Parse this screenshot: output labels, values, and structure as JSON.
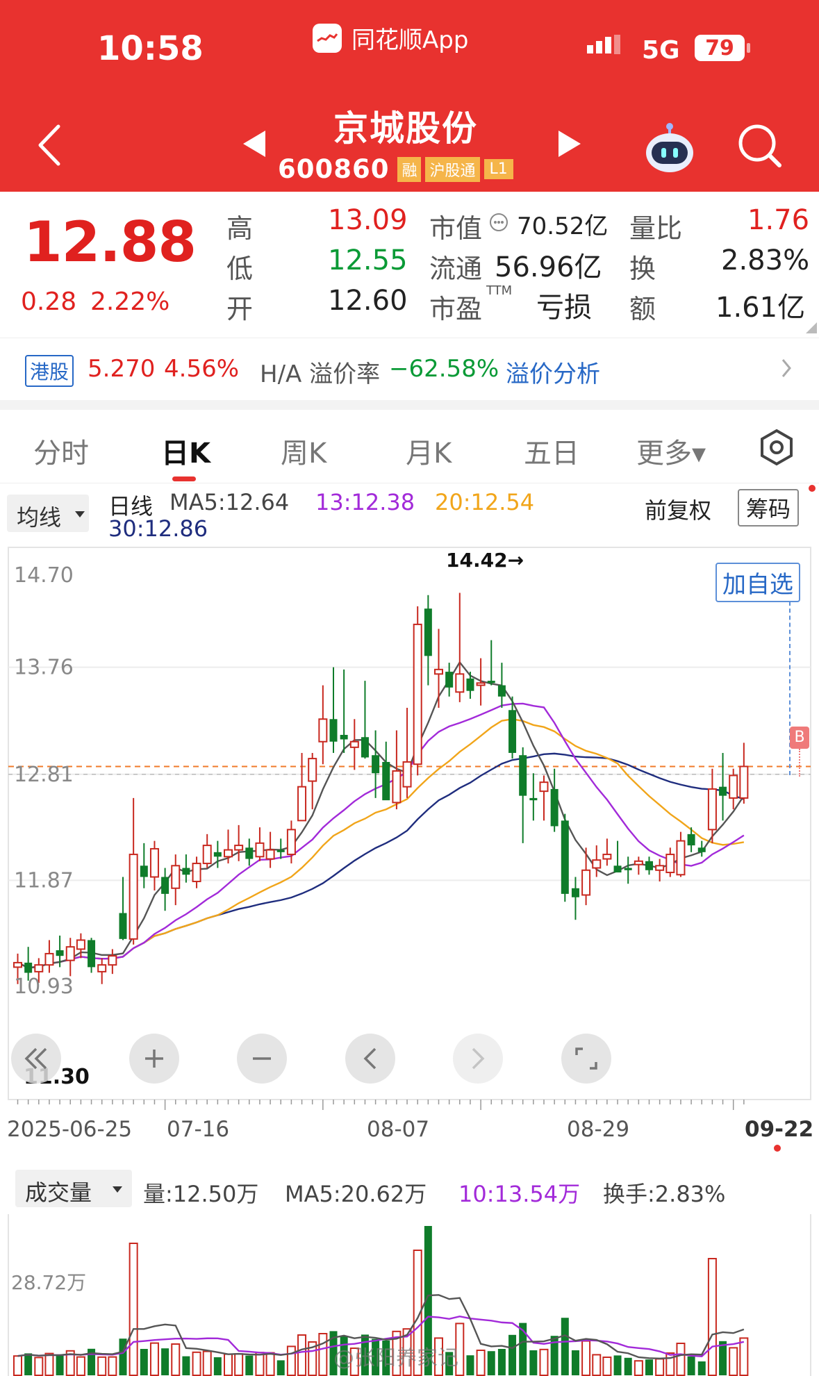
{
  "status_bar": {
    "time": "10:58",
    "app_label": "同花顺App",
    "network": "5G",
    "battery": "79"
  },
  "stock": {
    "name": "京城股份",
    "code": "600860",
    "badges": [
      "融",
      "沪股通",
      "L1"
    ]
  },
  "quote": {
    "price": "12.88",
    "change": "0.28",
    "change_pct": "2.22%",
    "high_label": "高",
    "high": "13.09",
    "low_label": "低",
    "low": "12.55",
    "open_label": "开",
    "open": "12.60",
    "mktcap_label": "市值",
    "mktcap": "70.52亿",
    "float_label": "流通",
    "float_cap": "56.96亿",
    "pe_label": "市盈",
    "pe_sup": "TTM",
    "pe": "亏损",
    "vol_ratio_label": "量比",
    "vol_ratio": "1.76",
    "turnover_label": "换",
    "turnover": "2.83%",
    "amount_label": "额",
    "amount": "1.61亿"
  },
  "hk": {
    "tag": "港股",
    "price": "5.270",
    "pct": "4.56%",
    "premium_label": "H/A 溢价率",
    "premium": "−62.58%",
    "analysis": "溢价分析"
  },
  "tabs": [
    {
      "label": "分时"
    },
    {
      "label": "日K"
    },
    {
      "label": "周K"
    },
    {
      "label": "月K"
    },
    {
      "label": "五日"
    },
    {
      "label": "更多▾"
    }
  ],
  "active_tab": "日K",
  "chart_header": {
    "indicator_btn": "均线",
    "line_label": "日线",
    "ma5": "MA5:12.64",
    "ma13": "13:12.38",
    "ma20": "20:12.54",
    "ma30": "30:12.86",
    "adjust": "前复权",
    "chips": "筹码"
  },
  "colors": {
    "up": "#c8281f",
    "down": "#0f7c2a",
    "ma5": "#555555",
    "ma13": "#a22ad9",
    "ma20": "#f1a51a",
    "ma30": "#1f2d7e",
    "brand": "#e8322f"
  },
  "add_watch": "加自选",
  "buy_marker": "B",
  "volume_header": {
    "btn": "成交量",
    "vol": "量:12.50万",
    "ma5": "MA5:20.62万",
    "ma10": "10:13.54万",
    "turnover": "换手:2.83%"
  },
  "watermark": "@张阳养家记",
  "chart_data": {
    "type": "candlestick",
    "y_ticks": [
      "14.70",
      "13.76",
      "12.81",
      "11.87",
      "10.93"
    ],
    "ylim": [
      10.93,
      14.7
    ],
    "x_ticks": [
      "2025-06-25",
      "07-16",
      "08-07",
      "08-29",
      "09-22"
    ],
    "max_annotation": "14.42→",
    "min_annotation": "11.30",
    "last_price_line": 12.88,
    "candles": [
      {
        "o": 11.1,
        "h": 11.22,
        "l": 10.95,
        "c": 11.14
      },
      {
        "o": 11.14,
        "h": 11.28,
        "l": 10.98,
        "c": 11.05
      },
      {
        "o": 11.06,
        "h": 11.18,
        "l": 10.96,
        "c": 11.12
      },
      {
        "o": 11.12,
        "h": 11.34,
        "l": 11.05,
        "c": 11.22
      },
      {
        "o": 11.25,
        "h": 11.38,
        "l": 11.1,
        "c": 11.2
      },
      {
        "o": 11.16,
        "h": 11.36,
        "l": 11.02,
        "c": 11.28
      },
      {
        "o": 11.26,
        "h": 11.4,
        "l": 11.18,
        "c": 11.34
      },
      {
        "o": 11.34,
        "h": 11.36,
        "l": 11.05,
        "c": 11.1
      },
      {
        "o": 11.06,
        "h": 11.18,
        "l": 10.95,
        "c": 11.12
      },
      {
        "o": 11.12,
        "h": 11.26,
        "l": 11.04,
        "c": 11.2
      },
      {
        "o": 11.58,
        "h": 11.9,
        "l": 11.34,
        "c": 11.35
      },
      {
        "o": 11.35,
        "h": 12.6,
        "l": 11.3,
        "c": 12.1
      },
      {
        "o": 12.0,
        "h": 12.2,
        "l": 11.8,
        "c": 11.9
      },
      {
        "o": 11.9,
        "h": 12.22,
        "l": 11.78,
        "c": 12.15
      },
      {
        "o": 11.9,
        "h": 11.98,
        "l": 11.6,
        "c": 11.75
      },
      {
        "o": 11.8,
        "h": 12.1,
        "l": 11.65,
        "c": 12.0
      },
      {
        "o": 11.98,
        "h": 12.1,
        "l": 11.85,
        "c": 11.92
      },
      {
        "o": 11.86,
        "h": 12.08,
        "l": 11.8,
        "c": 12.02
      },
      {
        "o": 12.02,
        "h": 12.28,
        "l": 11.98,
        "c": 12.18
      },
      {
        "o": 12.12,
        "h": 12.22,
        "l": 11.98,
        "c": 12.08
      },
      {
        "o": 12.08,
        "h": 12.32,
        "l": 12.02,
        "c": 12.14
      },
      {
        "o": 12.14,
        "h": 12.36,
        "l": 12.04,
        "c": 12.18
      },
      {
        "o": 12.16,
        "h": 12.24,
        "l": 12.0,
        "c": 12.06
      },
      {
        "o": 12.08,
        "h": 12.34,
        "l": 12.04,
        "c": 12.2
      },
      {
        "o": 12.06,
        "h": 12.3,
        "l": 11.98,
        "c": 12.14
      },
      {
        "o": 12.14,
        "h": 12.24,
        "l": 12.06,
        "c": 12.12
      },
      {
        "o": 12.1,
        "h": 12.4,
        "l": 12.02,
        "c": 12.32
      },
      {
        "o": 12.4,
        "h": 13.0,
        "l": 12.4,
        "c": 12.7
      },
      {
        "o": 12.75,
        "h": 13.0,
        "l": 12.5,
        "c": 12.95
      },
      {
        "o": 13.1,
        "h": 13.6,
        "l": 12.9,
        "c": 13.3
      },
      {
        "o": 13.3,
        "h": 13.76,
        "l": 13.0,
        "c": 13.1
      },
      {
        "o": 13.16,
        "h": 13.74,
        "l": 13.0,
        "c": 13.12
      },
      {
        "o": 13.05,
        "h": 13.3,
        "l": 12.85,
        "c": 13.1
      },
      {
        "o": 13.14,
        "h": 13.64,
        "l": 12.95,
        "c": 12.96
      },
      {
        "o": 12.98,
        "h": 13.2,
        "l": 12.6,
        "c": 12.82
      },
      {
        "o": 12.92,
        "h": 13.1,
        "l": 12.66,
        "c": 12.58
      },
      {
        "o": 12.56,
        "h": 13.2,
        "l": 12.5,
        "c": 12.84
      },
      {
        "o": 12.7,
        "h": 13.4,
        "l": 12.6,
        "c": 12.92
      },
      {
        "o": 12.9,
        "h": 14.3,
        "l": 12.8,
        "c": 14.14
      },
      {
        "o": 14.28,
        "h": 14.4,
        "l": 13.6,
        "c": 13.86
      },
      {
        "o": 13.7,
        "h": 14.1,
        "l": 13.4,
        "c": 13.74
      },
      {
        "o": 13.72,
        "h": 13.8,
        "l": 13.5,
        "c": 13.58
      },
      {
        "o": 13.54,
        "h": 14.42,
        "l": 13.45,
        "c": 13.7
      },
      {
        "o": 13.66,
        "h": 13.72,
        "l": 13.48,
        "c": 13.55
      },
      {
        "o": 13.6,
        "h": 13.84,
        "l": 13.42,
        "c": 13.62
      },
      {
        "o": 13.64,
        "h": 14.0,
        "l": 13.6,
        "c": 13.62
      },
      {
        "o": 13.6,
        "h": 13.8,
        "l": 13.4,
        "c": 13.5
      },
      {
        "o": 13.38,
        "h": 13.5,
        "l": 12.95,
        "c": 13.0
      },
      {
        "o": 12.98,
        "h": 13.05,
        "l": 12.2,
        "c": 12.62
      },
      {
        "o": 12.6,
        "h": 12.82,
        "l": 12.4,
        "c": 12.58
      },
      {
        "o": 12.66,
        "h": 12.8,
        "l": 12.4,
        "c": 12.74
      },
      {
        "o": 12.68,
        "h": 12.86,
        "l": 12.3,
        "c": 12.35
      },
      {
        "o": 12.4,
        "h": 12.46,
        "l": 11.68,
        "c": 11.75
      },
      {
        "o": 11.8,
        "h": 11.9,
        "l": 11.52,
        "c": 11.72
      },
      {
        "o": 11.74,
        "h": 12.16,
        "l": 11.65,
        "c": 11.96
      },
      {
        "o": 11.98,
        "h": 12.18,
        "l": 11.9,
        "c": 12.05
      },
      {
        "o": 12.06,
        "h": 12.24,
        "l": 12.0,
        "c": 12.1
      },
      {
        "o": 12.0,
        "h": 12.22,
        "l": 11.95,
        "c": 11.94
      },
      {
        "o": 11.98,
        "h": 12.08,
        "l": 11.84,
        "c": 11.96
      },
      {
        "o": 12.01,
        "h": 12.08,
        "l": 11.92,
        "c": 12.04
      },
      {
        "o": 12.04,
        "h": 12.08,
        "l": 11.92,
        "c": 11.96
      },
      {
        "o": 11.96,
        "h": 12.06,
        "l": 11.86,
        "c": 12.0
      },
      {
        "o": 11.94,
        "h": 12.16,
        "l": 11.9,
        "c": 12.1
      },
      {
        "o": 11.92,
        "h": 12.3,
        "l": 11.9,
        "c": 12.22
      },
      {
        "o": 12.28,
        "h": 12.34,
        "l": 12.12,
        "c": 12.18
      },
      {
        "o": 12.16,
        "h": 12.22,
        "l": 12.08,
        "c": 12.12
      },
      {
        "o": 12.32,
        "h": 12.86,
        "l": 12.2,
        "c": 12.68
      },
      {
        "o": 12.7,
        "h": 13.0,
        "l": 12.4,
        "c": 12.62
      },
      {
        "o": 12.6,
        "h": 12.86,
        "l": 12.5,
        "c": 12.8
      },
      {
        "o": 12.6,
        "h": 13.09,
        "l": 12.55,
        "c": 12.88
      }
    ]
  }
}
